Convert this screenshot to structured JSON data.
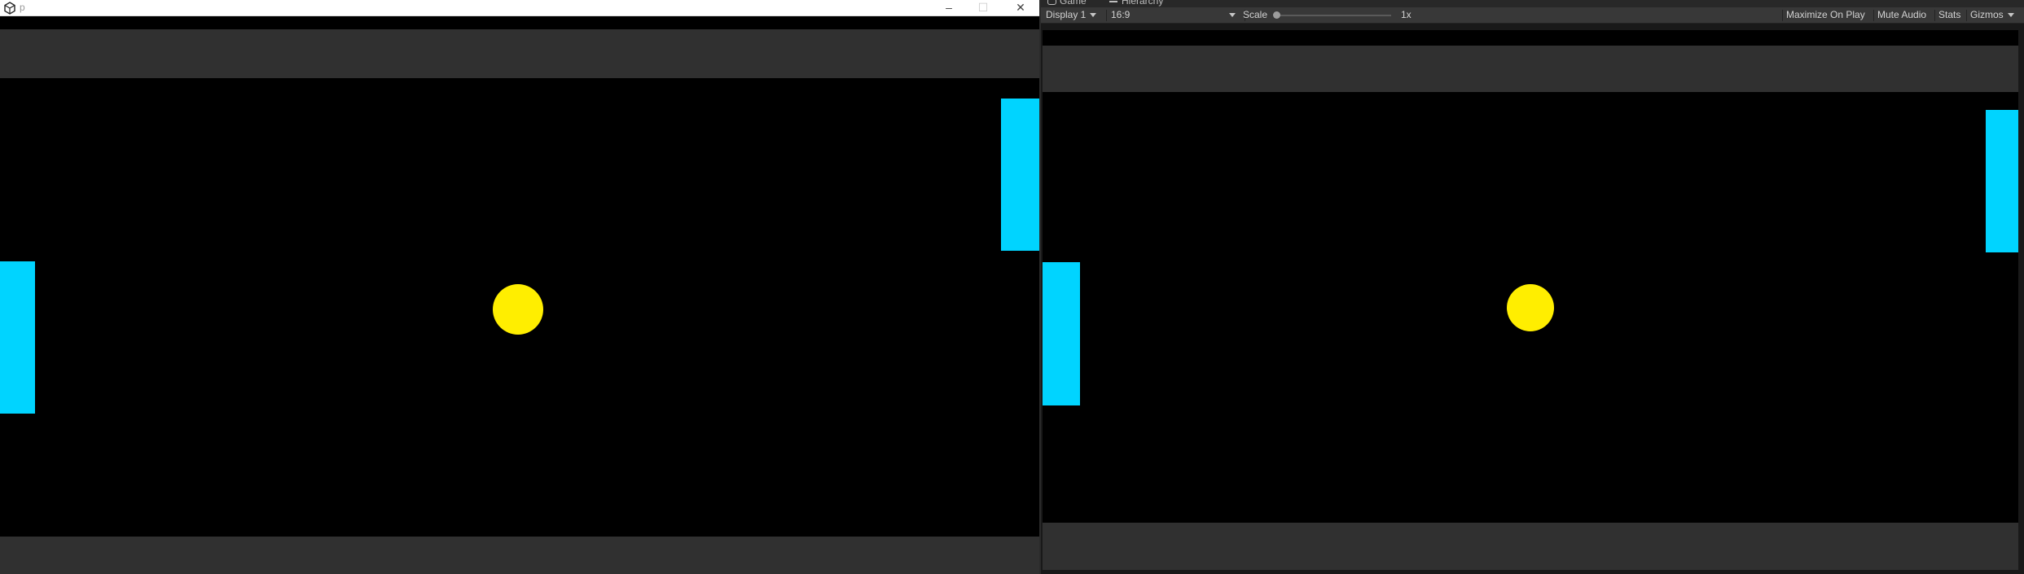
{
  "player": {
    "title": "p",
    "icon": "unity-logo-icon",
    "controls": {
      "minimize": "–",
      "maximize": "☐",
      "close": "✕"
    }
  },
  "editor": {
    "tabs": [
      {
        "label": "Game",
        "icon": "game-controller-icon"
      },
      {
        "label": "Hierarchy",
        "icon": "hierarchy-list-icon"
      }
    ],
    "toolbar": {
      "display": "Display 1",
      "aspect": "16:9",
      "scale_label": "Scale",
      "scale_value": "1x",
      "maximize_on_play": "Maximize On Play",
      "mute_audio": "Mute Audio",
      "stats": "Stats",
      "gizmos": "Gizmos"
    }
  },
  "colors": {
    "letterbox_bar": "#303030",
    "background": "#000000",
    "paddle": "#00d4ff",
    "ball": "#ffee00"
  }
}
